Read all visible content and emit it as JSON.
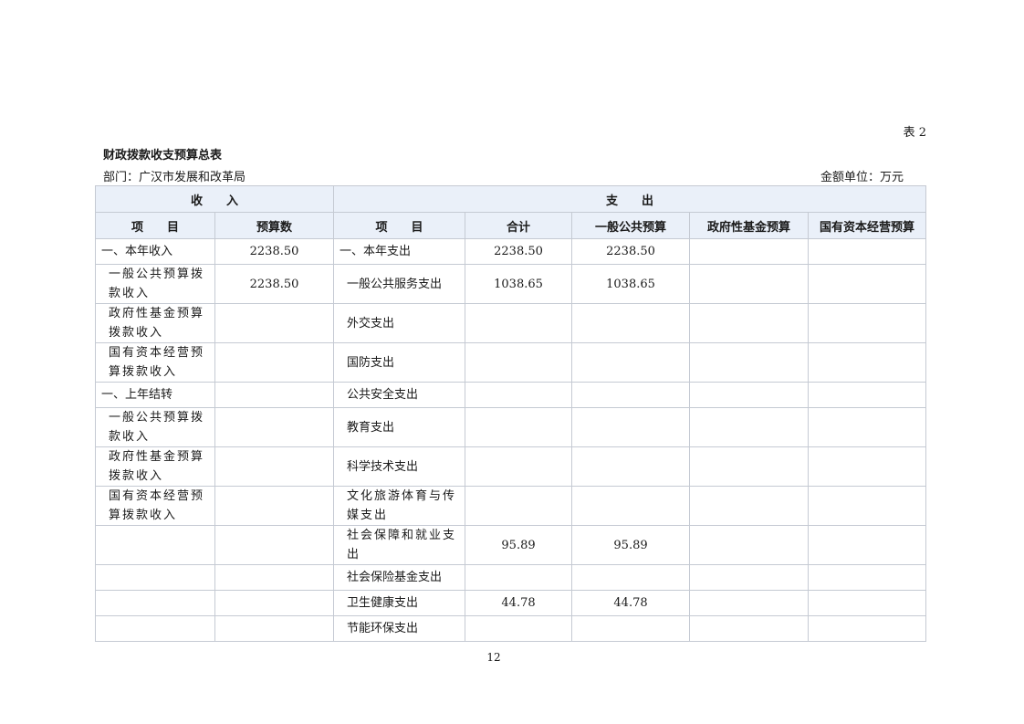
{
  "table_no": "表 2",
  "title": "财政拨款收支预算总表",
  "department": "部门：广汉市发展和改革局",
  "unit": "金额单位：万元",
  "page_number": "12",
  "group_headers": {
    "income": "收　　入",
    "expense": "支　　出"
  },
  "columns": {
    "income_item": "项　　目",
    "income_budget": "预算数",
    "expense_item": "项　　目",
    "total": "合计",
    "general_budget": "一般公共预算",
    "gov_fund_budget": "政府性基金预算",
    "state_capital_budget": "国有资本经营预算"
  },
  "rows": [
    {
      "income_item": "一、本年收入",
      "income_budget": "2238.50",
      "expense_item": "一、本年支出",
      "total": "2238.50",
      "general_budget": "2238.50",
      "gov_fund_budget": "",
      "state_capital_budget": ""
    },
    {
      "income_item": "一般公共预算拨款收入",
      "income_budget": "2238.50",
      "expense_item": "一般公共服务支出",
      "total": "1038.65",
      "general_budget": "1038.65",
      "gov_fund_budget": "",
      "state_capital_budget": ""
    },
    {
      "income_item": "政府性基金预算拨款收入",
      "income_budget": "",
      "expense_item": "外交支出",
      "total": "",
      "general_budget": "",
      "gov_fund_budget": "",
      "state_capital_budget": ""
    },
    {
      "income_item": "国有资本经营预算拨款收入",
      "income_budget": "",
      "expense_item": "国防支出",
      "total": "",
      "general_budget": "",
      "gov_fund_budget": "",
      "state_capital_budget": ""
    },
    {
      "income_item": "一、上年结转",
      "income_budget": "",
      "expense_item": "公共安全支出",
      "total": "",
      "general_budget": "",
      "gov_fund_budget": "",
      "state_capital_budget": ""
    },
    {
      "income_item": "一般公共预算拨款收入",
      "income_budget": "",
      "expense_item": "教育支出",
      "total": "",
      "general_budget": "",
      "gov_fund_budget": "",
      "state_capital_budget": ""
    },
    {
      "income_item": "政府性基金预算拨款收入",
      "income_budget": "",
      "expense_item": "科学技术支出",
      "total": "",
      "general_budget": "",
      "gov_fund_budget": "",
      "state_capital_budget": ""
    },
    {
      "income_item": "国有资本经营预算拨款收入",
      "income_budget": "",
      "expense_item": "文化旅游体育与传媒支出",
      "total": "",
      "general_budget": "",
      "gov_fund_budget": "",
      "state_capital_budget": ""
    },
    {
      "income_item": "",
      "income_budget": "",
      "expense_item": "社会保障和就业支出",
      "total": "95.89",
      "general_budget": "95.89",
      "gov_fund_budget": "",
      "state_capital_budget": ""
    },
    {
      "income_item": "",
      "income_budget": "",
      "expense_item": "社会保险基金支出",
      "total": "",
      "general_budget": "",
      "gov_fund_budget": "",
      "state_capital_budget": ""
    },
    {
      "income_item": "",
      "income_budget": "",
      "expense_item": "卫生健康支出",
      "total": "44.78",
      "general_budget": "44.78",
      "gov_fund_budget": "",
      "state_capital_budget": ""
    },
    {
      "income_item": "",
      "income_budget": "",
      "expense_item": "节能环保支出",
      "total": "",
      "general_budget": "",
      "gov_fund_budget": "",
      "state_capital_budget": ""
    }
  ]
}
